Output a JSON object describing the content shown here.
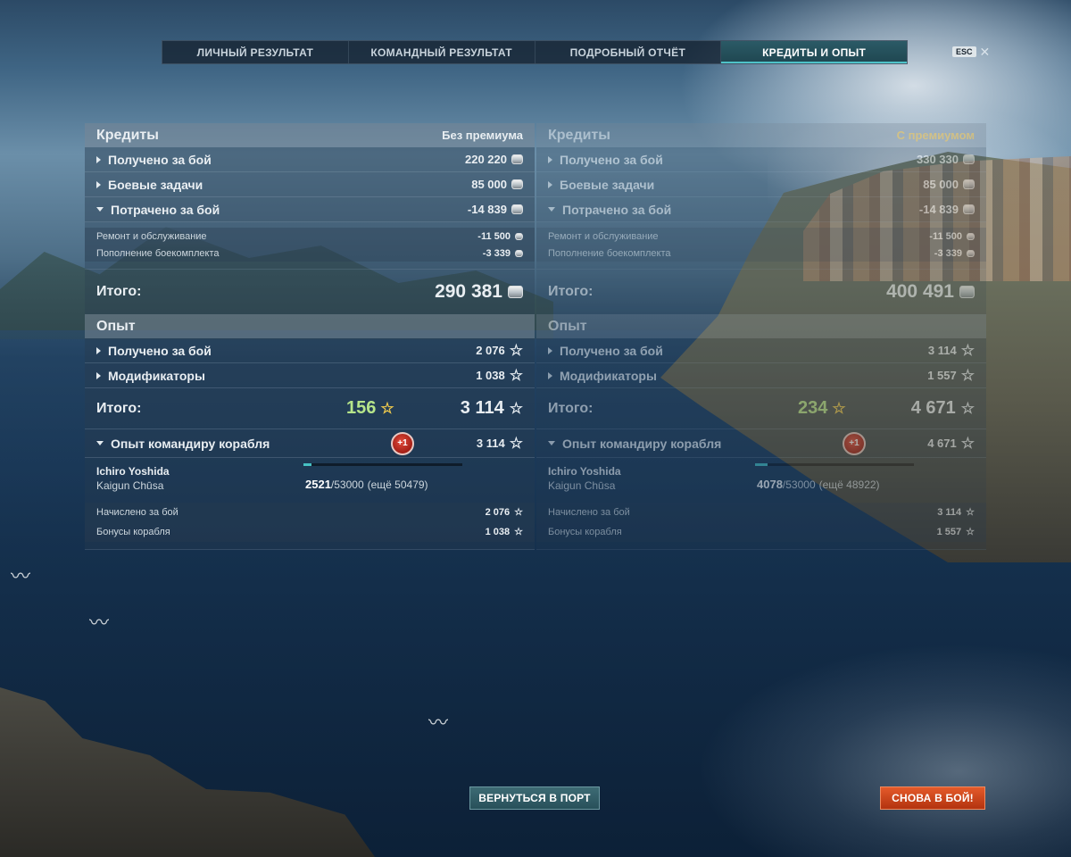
{
  "tabs": [
    {
      "label": "ЛИЧНЫЙ РЕЗУЛЬТАТ",
      "active": false
    },
    {
      "label": "КОМАНДНЫЙ РЕЗУЛЬТАТ",
      "active": false
    },
    {
      "label": "ПОДРОБНЫЙ ОТЧЁТ",
      "active": false
    },
    {
      "label": "КРЕДИТЫ И ОПЫТ",
      "active": true
    }
  ],
  "esc": {
    "key": "ESC",
    "close": "✕"
  },
  "left": {
    "credits": {
      "title": "Кредиты",
      "mode": "Без премиума",
      "earned": {
        "label": "Получено за бой",
        "value": "220 220"
      },
      "tasks": {
        "label": "Боевые задачи",
        "value": "85 000"
      },
      "spent": {
        "label": "Потрачено за бой",
        "value": "-14 839"
      },
      "repair": {
        "label": "Ремонт и обслуживание",
        "value": "-11 500"
      },
      "ammo": {
        "label": "Пополнение боекомплекта",
        "value": "-3 339"
      },
      "total": {
        "label": "Итого:",
        "value": "290 381"
      }
    },
    "xp": {
      "title": "Опыт",
      "earned": {
        "label": "Получено за бой",
        "value": "2 076"
      },
      "modifiers": {
        "label": "Модификаторы",
        "value": "1 038"
      },
      "total": {
        "label": "Итого:",
        "premium": "156",
        "value": "3 114"
      },
      "commander": {
        "label": "Опыт командиру корабля",
        "badge": "+1",
        "value": "3 114"
      }
    },
    "cmdr": {
      "name": "Ichiro Yoshida",
      "rank": "Kaigun Chūsa",
      "xp_current": "2521",
      "xp_total": "/53000",
      "xp_remaining": "(ещё 50479)",
      "progress": 0.048,
      "battle": {
        "label": "Начислено за бой",
        "value": "2 076"
      },
      "bonus": {
        "label": "Бонусы корабля",
        "value": "1 038"
      }
    }
  },
  "right": {
    "credits": {
      "title": "Кредиты",
      "mode": "С премиумом",
      "earned": {
        "label": "Получено за бой",
        "value": "330 330"
      },
      "tasks": {
        "label": "Боевые задачи",
        "value": "85 000"
      },
      "spent": {
        "label": "Потрачено за бой",
        "value": "-14 839"
      },
      "repair": {
        "label": "Ремонт и обслуживание",
        "value": "-11 500"
      },
      "ammo": {
        "label": "Пополнение боекомплекта",
        "value": "-3 339"
      },
      "total": {
        "label": "Итого:",
        "value": "400 491"
      }
    },
    "xp": {
      "title": "Опыт",
      "earned": {
        "label": "Получено за бой",
        "value": "3 114"
      },
      "modifiers": {
        "label": "Модификаторы",
        "value": "1 557"
      },
      "total": {
        "label": "Итого:",
        "premium": "234",
        "value": "4 671"
      },
      "commander": {
        "label": "Опыт командиру корабля",
        "badge": "+1",
        "value": "4 671"
      }
    },
    "cmdr": {
      "name": "Ichiro Yoshida",
      "rank": "Kaigun Chūsa",
      "xp_current": "4078",
      "xp_total": "/53000",
      "xp_remaining": "(ещё 48922)",
      "progress": 0.077,
      "battle": {
        "label": "Начислено за бой",
        "value": "3 114"
      },
      "bonus": {
        "label": "Бонусы корабля",
        "value": "1 557"
      }
    }
  },
  "buttons": {
    "port": "ВЕРНУТЬСЯ В ПОРТ",
    "battle": "СНОВА В БОЙ!"
  },
  "colors": {
    "active_tab": "#1f4650",
    "premium_label": "#f0c14a",
    "premium_xp": "#b6e58a",
    "battle_button": "#c9441a",
    "port_button": "#2f5c66"
  }
}
